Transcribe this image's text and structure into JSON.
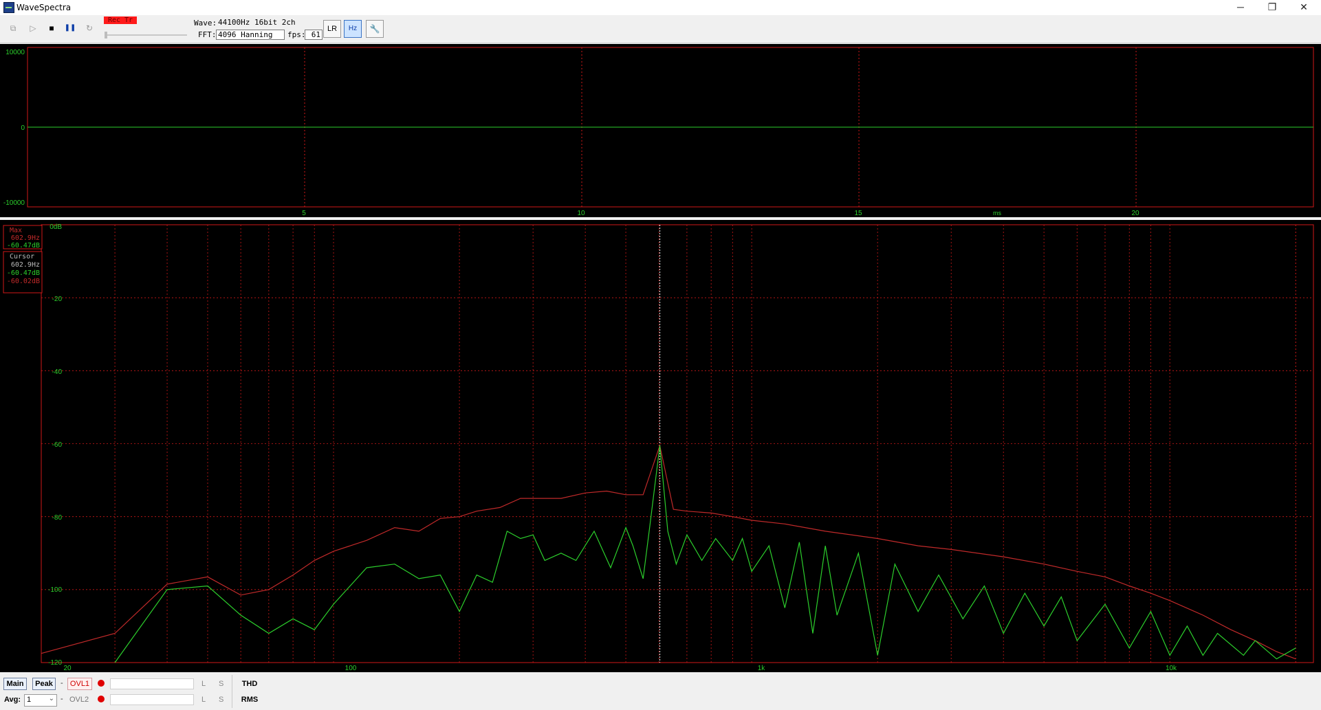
{
  "window": {
    "title": "WaveSpectra",
    "minimize": "─",
    "restore": "❐",
    "close": "✕"
  },
  "toolbar": {
    "rec_label": "Rec Tr",
    "wave_label": "Wave:",
    "wave_value": "44100Hz 16bit 2ch",
    "fft_label": "FFT:",
    "fft_value": "4096 Hanning",
    "fps_label": "fps:",
    "fps_value": "61",
    "buttons": {
      "copy": "⧉",
      "play": "▷",
      "stop": "■",
      "pause": "❚❚",
      "loop": "↻",
      "channel": "LR",
      "freq": "Hz",
      "settings": "🔧"
    }
  },
  "colors": {
    "grid": "#d01818",
    "green": "#2ccf2c",
    "red": "#c12a2a",
    "axis_text": "#2ccf2c",
    "cursor": "#cccccc"
  },
  "wave_panel": {
    "ylabels": [
      "10000",
      "0",
      "-10000"
    ],
    "xlabels": [
      "5",
      "10",
      "15",
      "20"
    ],
    "unit": "ms",
    "ylim": [
      -10000,
      10000
    ],
    "xlim": [
      0,
      23.2
    ]
  },
  "spectrum_panel": {
    "ylabels": [
      "0dB",
      "-20",
      "-40",
      "-60",
      "-80",
      "-100",
      "-120"
    ],
    "xlabels": [
      "20",
      "100",
      "1k",
      "10k"
    ],
    "ylim": [
      -120,
      0
    ],
    "xlim": [
      20,
      22050
    ],
    "max_box": {
      "title": "Max",
      "freq": "602.9Hz",
      "db": "-60.47dB"
    },
    "cursor_box": {
      "title": "Cursor",
      "freq": "602.9Hz",
      "db_l": "-60.47dB",
      "db_r": "-60.02dB"
    },
    "cursor_freq": 602.9
  },
  "chart_data": {
    "type": "line",
    "xlabel": "",
    "ylabel": "",
    "x_scale": "log",
    "xlim": [
      20,
      22050
    ],
    "ylim": [
      -120,
      0
    ],
    "series": [
      {
        "points": [
          [
            20,
            -117.5
          ],
          [
            30,
            -112
          ],
          [
            40,
            -98.5
          ],
          [
            50,
            -96.5
          ],
          [
            60,
            -101.5
          ],
          [
            70,
            -100
          ],
          [
            80,
            -96
          ],
          [
            90,
            -92
          ],
          [
            100,
            -89.5
          ],
          [
            120,
            -86.5
          ],
          [
            140,
            -83
          ],
          [
            160,
            -84
          ],
          [
            180,
            -80.5
          ],
          [
            200,
            -80
          ],
          [
            220,
            -78.5
          ],
          [
            250,
            -77.5
          ],
          [
            280,
            -75
          ],
          [
            300,
            -75
          ],
          [
            350,
            -75
          ],
          [
            400,
            -73.5
          ],
          [
            450,
            -73
          ],
          [
            500,
            -74
          ],
          [
            550,
            -74
          ],
          [
            602.9,
            -60.5
          ],
          [
            650,
            -78
          ],
          [
            700,
            -78.5
          ],
          [
            800,
            -79
          ],
          [
            900,
            -80
          ],
          [
            1000,
            -81
          ],
          [
            1200,
            -82
          ],
          [
            1500,
            -84
          ],
          [
            2000,
            -86
          ],
          [
            2500,
            -88
          ],
          [
            3000,
            -89
          ],
          [
            4000,
            -91
          ],
          [
            5000,
            -93
          ],
          [
            6000,
            -95
          ],
          [
            7000,
            -96.5
          ],
          [
            8000,
            -99
          ],
          [
            9000,
            -101
          ],
          [
            10000,
            -103
          ],
          [
            12000,
            -107
          ],
          [
            14000,
            -111
          ],
          [
            16000,
            -114
          ],
          [
            18000,
            -117
          ],
          [
            20000,
            -119
          ]
        ]
      },
      {
        "points": [
          [
            30,
            -120
          ],
          [
            40,
            -100
          ],
          [
            50,
            -99
          ],
          [
            60,
            -107
          ],
          [
            70,
            -112
          ],
          [
            80,
            -108
          ],
          [
            90,
            -111
          ],
          [
            100,
            -104
          ],
          [
            120,
            -94
          ],
          [
            140,
            -93
          ],
          [
            160,
            -97
          ],
          [
            180,
            -96
          ],
          [
            200,
            -106
          ],
          [
            220,
            -96
          ],
          [
            240,
            -98
          ],
          [
            260,
            -84
          ],
          [
            280,
            -86
          ],
          [
            300,
            -85
          ],
          [
            320,
            -92
          ],
          [
            350,
            -90
          ],
          [
            380,
            -92
          ],
          [
            420,
            -84
          ],
          [
            460,
            -94
          ],
          [
            500,
            -83
          ],
          [
            520,
            -88
          ],
          [
            550,
            -97
          ],
          [
            570,
            -83
          ],
          [
            602.9,
            -60.5
          ],
          [
            630,
            -84
          ],
          [
            660,
            -93
          ],
          [
            700,
            -85
          ],
          [
            760,
            -92
          ],
          [
            820,
            -86
          ],
          [
            900,
            -92
          ],
          [
            950,
            -86
          ],
          [
            1000,
            -95
          ],
          [
            1100,
            -88
          ],
          [
            1200,
            -105
          ],
          [
            1300,
            -87
          ],
          [
            1400,
            -112
          ],
          [
            1500,
            -88
          ],
          [
            1600,
            -107
          ],
          [
            1800,
            -90
          ],
          [
            2000,
            -118
          ],
          [
            2200,
            -93
          ],
          [
            2500,
            -106
          ],
          [
            2800,
            -96
          ],
          [
            3200,
            -108
          ],
          [
            3600,
            -99
          ],
          [
            4000,
            -112
          ],
          [
            4500,
            -101
          ],
          [
            5000,
            -110
          ],
          [
            5500,
            -102
          ],
          [
            6000,
            -114
          ],
          [
            7000,
            -104
          ],
          [
            8000,
            -116
          ],
          [
            9000,
            -106
          ],
          [
            10000,
            -118
          ],
          [
            11000,
            -110
          ],
          [
            12000,
            -118
          ],
          [
            13000,
            -112
          ],
          [
            15000,
            -118
          ],
          [
            16000,
            -114
          ],
          [
            18000,
            -119
          ],
          [
            20000,
            -116
          ]
        ]
      }
    ]
  },
  "bottom": {
    "main": "Main",
    "peak": "Peak",
    "dash": "-",
    "ovl1": "OVL1",
    "ovl2": "OVL2",
    "l": "L",
    "s": "S",
    "thd": "THD",
    "rms": "RMS",
    "avg_label": "Avg:",
    "avg_value": "1"
  }
}
